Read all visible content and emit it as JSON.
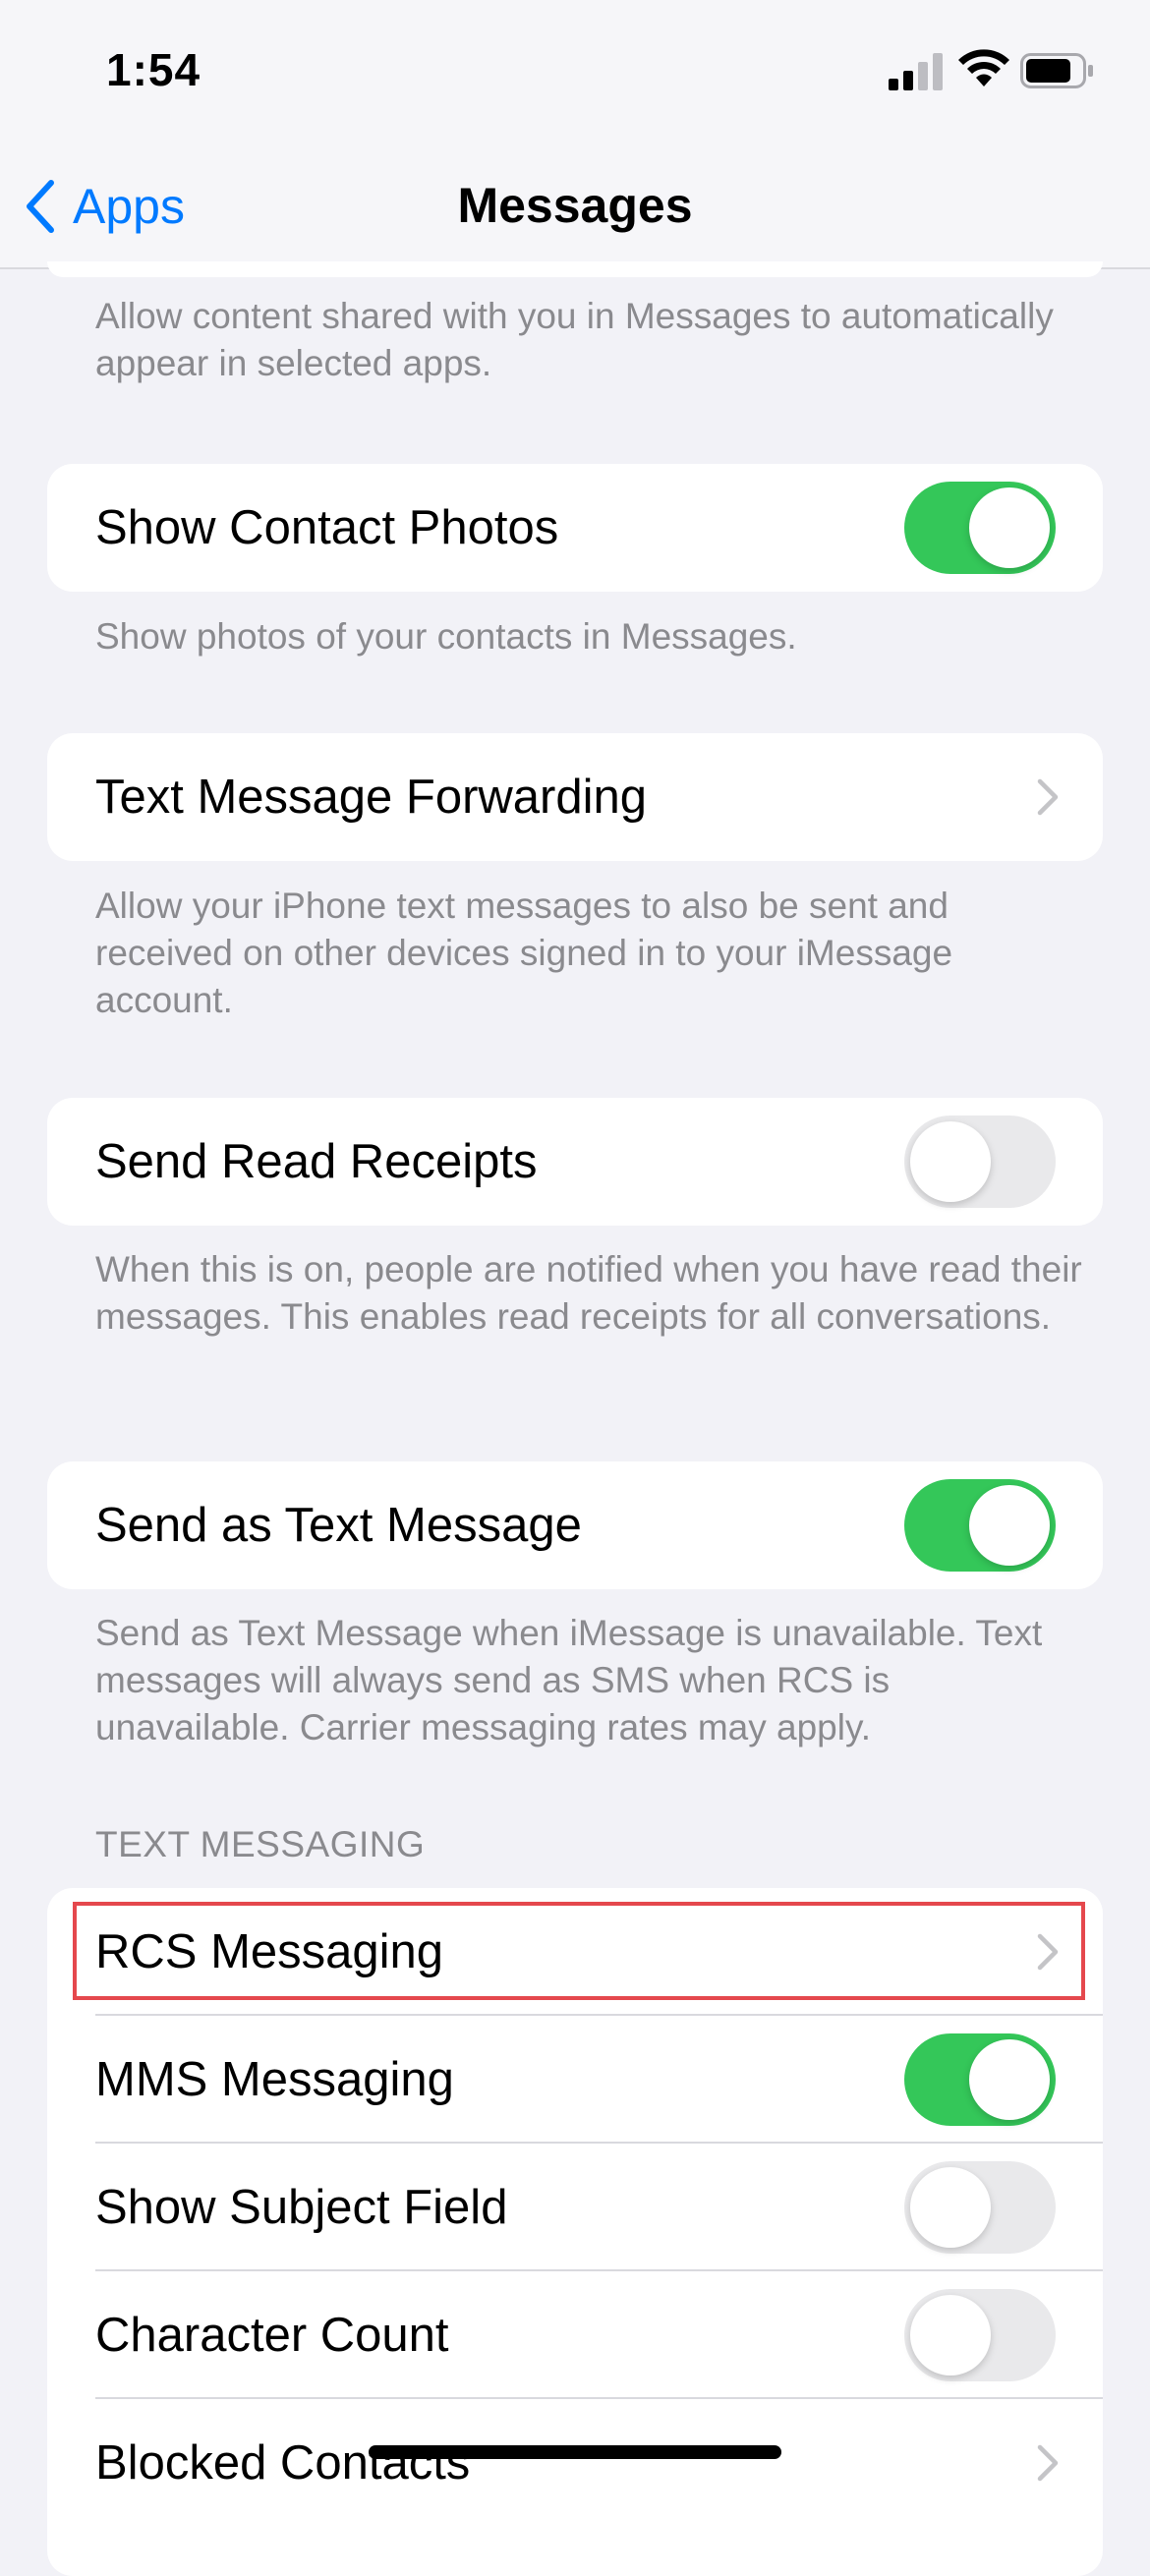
{
  "status_bar": {
    "time": "1:54"
  },
  "nav": {
    "back_label": "Apps",
    "title": "Messages"
  },
  "sections": {
    "top_footer": "Allow content shared with you in Messages to automatically appear in selected apps.",
    "show_contact_photos": {
      "label": "Show Contact Photos",
      "toggle": "on",
      "footer": "Show photos of your contacts in Messages."
    },
    "text_message_forwarding": {
      "label": "Text Message Forwarding",
      "footer": "Allow your iPhone text messages to also be sent and received on other devices signed in to your iMessage account."
    },
    "send_read_receipts": {
      "label": "Send Read Receipts",
      "toggle": "off",
      "footer": "When this is on, people are notified when you have read their messages. This enables read receipts for all conversations."
    },
    "send_as_text": {
      "label": "Send as Text Message",
      "toggle": "on",
      "footer": "Send as Text Message when iMessage is unavailable. Text messages will always send as SMS when RCS is unavailable. Carrier messaging rates may apply."
    },
    "text_messaging": {
      "header": "TEXT MESSAGING",
      "rows": [
        {
          "label": "RCS Messaging",
          "type": "chevron"
        },
        {
          "label": "MMS Messaging",
          "type": "toggle",
          "toggle": "on"
        },
        {
          "label": "Show Subject Field",
          "type": "toggle",
          "toggle": "off"
        },
        {
          "label": "Character Count",
          "type": "toggle",
          "toggle": "off"
        },
        {
          "label": "Blocked Contacts",
          "type": "chevron"
        }
      ]
    }
  },
  "colors": {
    "accent": "#007AFF",
    "toggle_on": "#34C759",
    "toggle_off": "#E9E9EB",
    "highlight": "#E5484D"
  }
}
